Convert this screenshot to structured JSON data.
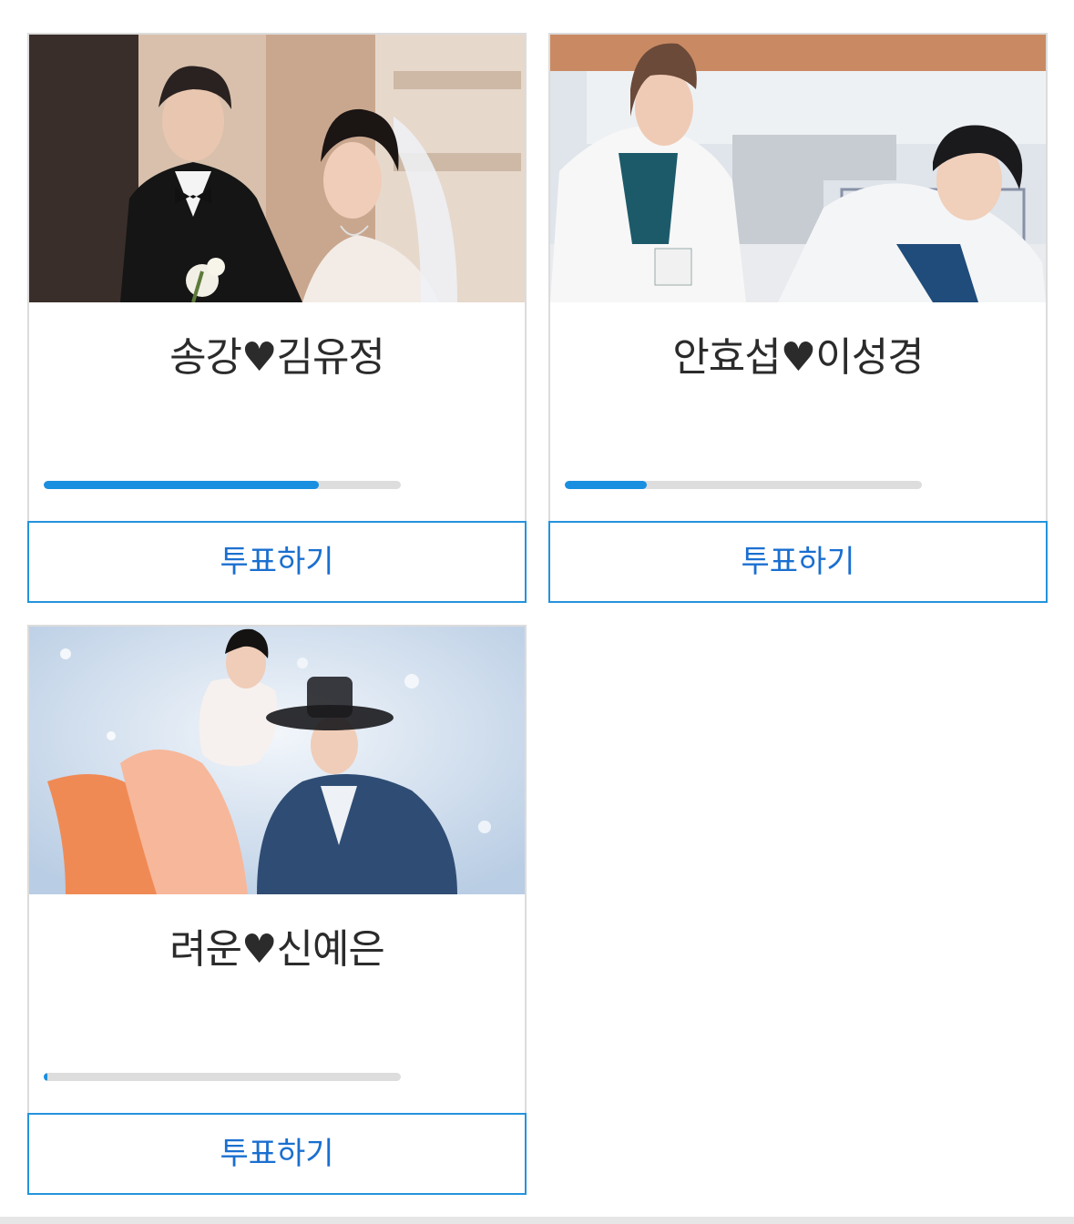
{
  "candidates": [
    {
      "name": "송강♥김유정",
      "vote_share": 0.77,
      "vote_label": "투표하기",
      "accent": "#1a8fe0"
    },
    {
      "name": "안효섭♥이성경",
      "vote_share": 0.23,
      "vote_label": "투표하기",
      "accent": "#1a8fe0"
    },
    {
      "name": "려운♥신예은",
      "vote_share": 0.01,
      "vote_label": "투표하기",
      "accent": "#1a8fe0"
    }
  ],
  "colors": {
    "button_border": "#2593dc",
    "button_text": "#1a6fd0",
    "bar_track": "#dddddd"
  }
}
